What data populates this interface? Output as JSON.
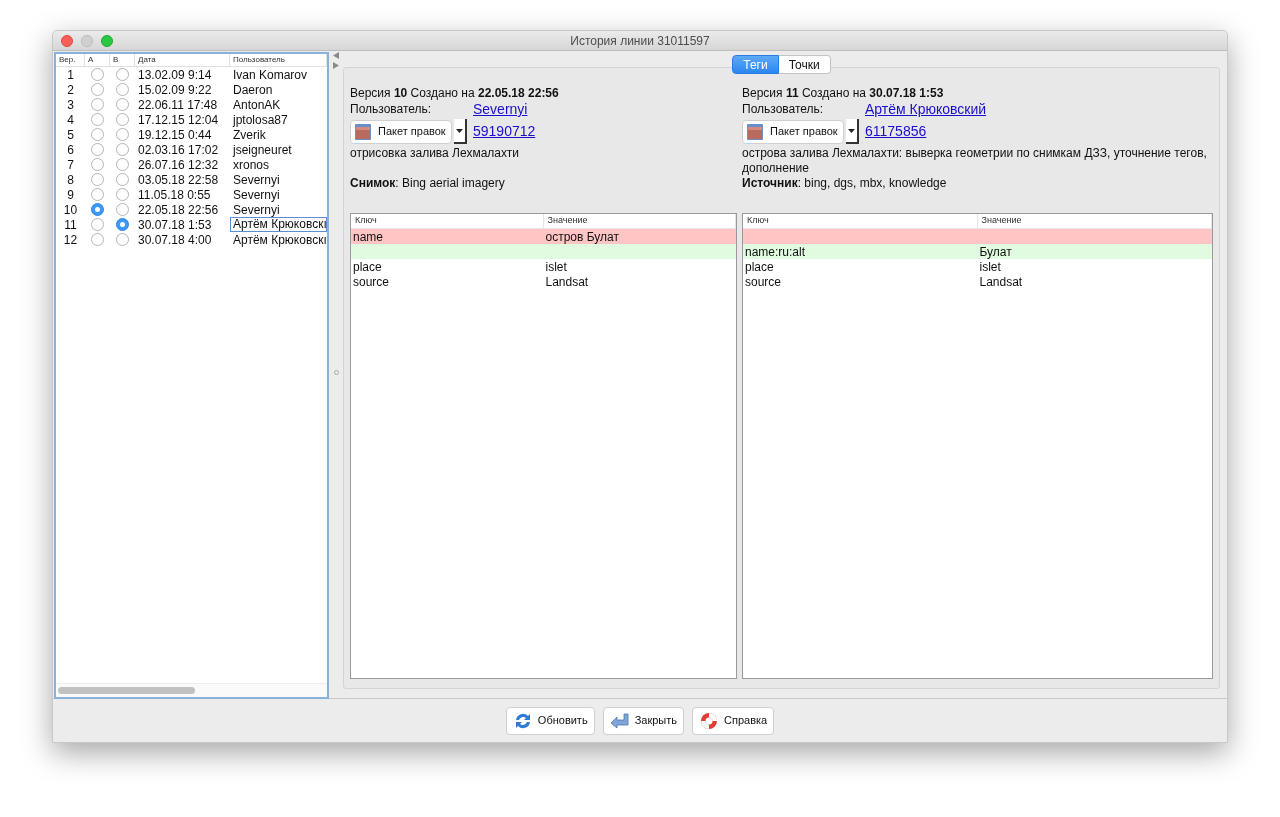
{
  "window": {
    "title": "История линии 31011597"
  },
  "versions": {
    "columns": [
      "Вер.",
      "A",
      "B",
      "Дата",
      "Пользователь"
    ],
    "rows": [
      {
        "ver": "1",
        "a_selected": false,
        "b_selected": false,
        "date": "13.02.09 9:14",
        "user": "Ivan Komarov",
        "focused": false
      },
      {
        "ver": "2",
        "a_selected": false,
        "b_selected": false,
        "date": "15.02.09 9:22",
        "user": "Daeron",
        "focused": false
      },
      {
        "ver": "3",
        "a_selected": false,
        "b_selected": false,
        "date": "22.06.11 17:48",
        "user": "AntonAK",
        "focused": false
      },
      {
        "ver": "4",
        "a_selected": false,
        "b_selected": false,
        "date": "17.12.15 12:04",
        "user": "jptolosa87",
        "focused": false
      },
      {
        "ver": "5",
        "a_selected": false,
        "b_selected": false,
        "date": "19.12.15 0:44",
        "user": "Zverik",
        "focused": false
      },
      {
        "ver": "6",
        "a_selected": false,
        "b_selected": false,
        "date": "02.03.16 17:02",
        "user": "jseigneuret",
        "focused": false
      },
      {
        "ver": "7",
        "a_selected": false,
        "b_selected": false,
        "date": "26.07.16 12:32",
        "user": "xronos",
        "focused": false
      },
      {
        "ver": "8",
        "a_selected": false,
        "b_selected": false,
        "date": "03.05.18 22:58",
        "user": "Severnyi",
        "focused": false
      },
      {
        "ver": "9",
        "a_selected": false,
        "b_selected": false,
        "date": "11.05.18 0:55",
        "user": "Severnyi",
        "focused": false
      },
      {
        "ver": "10",
        "a_selected": true,
        "b_selected": false,
        "date": "22.05.18 22:56",
        "user": "Severnyi",
        "focused": false
      },
      {
        "ver": "11",
        "a_selected": false,
        "b_selected": true,
        "date": "30.07.18 1:53",
        "user": "Артём Крюковскı",
        "focused": true
      },
      {
        "ver": "12",
        "a_selected": false,
        "b_selected": false,
        "date": "30.07.18 4:00",
        "user": "Артём Крюковскı",
        "focused": false
      }
    ]
  },
  "tabs": [
    {
      "label": "Теги",
      "selected": true
    },
    {
      "label": "Точки",
      "selected": false
    }
  ],
  "panels": [
    {
      "heading": "Версия **10** Создано на **22.05.18 22:56**",
      "user_label": "Пользователь:",
      "user": "Severnyi",
      "changeset_button": "Пакет правок",
      "changeset": "59190712",
      "comment": "отрисовка залива Лехмалахти",
      "source": "**Снимок**: Bing aerial imagery",
      "table": {
        "columns": [
          "Ключ",
          "Значение"
        ],
        "rows": [
          {
            "color": "#ffc4c4",
            "key": "name",
            "value": "остров Булат"
          },
          {
            "color": "#e0fbe0"
          },
          {
            "color": "#ffffff",
            "key": "place",
            "value": "islet"
          },
          {
            "color": "#ffffff",
            "key": "source",
            "value": "Landsat"
          }
        ]
      }
    },
    {
      "heading": "Версия **11** Создано на **30.07.18 1:53**",
      "user_label": "Пользователь:",
      "user": "Артём Крюковский",
      "changeset_button": "Пакет правок",
      "changeset": "61175856",
      "comment": "острова залива Лехмалахти: выверка геометрии по снимкам ДЗЗ, уточнение тегов, дополнение",
      "source": "**Источник**: bing, dgs, mbx, knowledge",
      "table": {
        "columns": [
          "Ключ",
          "Значение"
        ],
        "rows": [
          {
            "color": "#ffc4c4"
          },
          {
            "color": "#e0fbe0",
            "key": "name:ru:alt",
            "value": "Булат"
          },
          {
            "color": "#ffffff",
            "key": "place",
            "value": "islet"
          },
          {
            "color": "#ffffff",
            "key": "source",
            "value": "Landsat"
          }
        ]
      }
    }
  ],
  "buttons": [
    {
      "kind": "refresh",
      "label": "Обновить"
    },
    {
      "kind": "close",
      "label": "Закрыть"
    },
    {
      "kind": "help",
      "label": "Справка"
    }
  ]
}
